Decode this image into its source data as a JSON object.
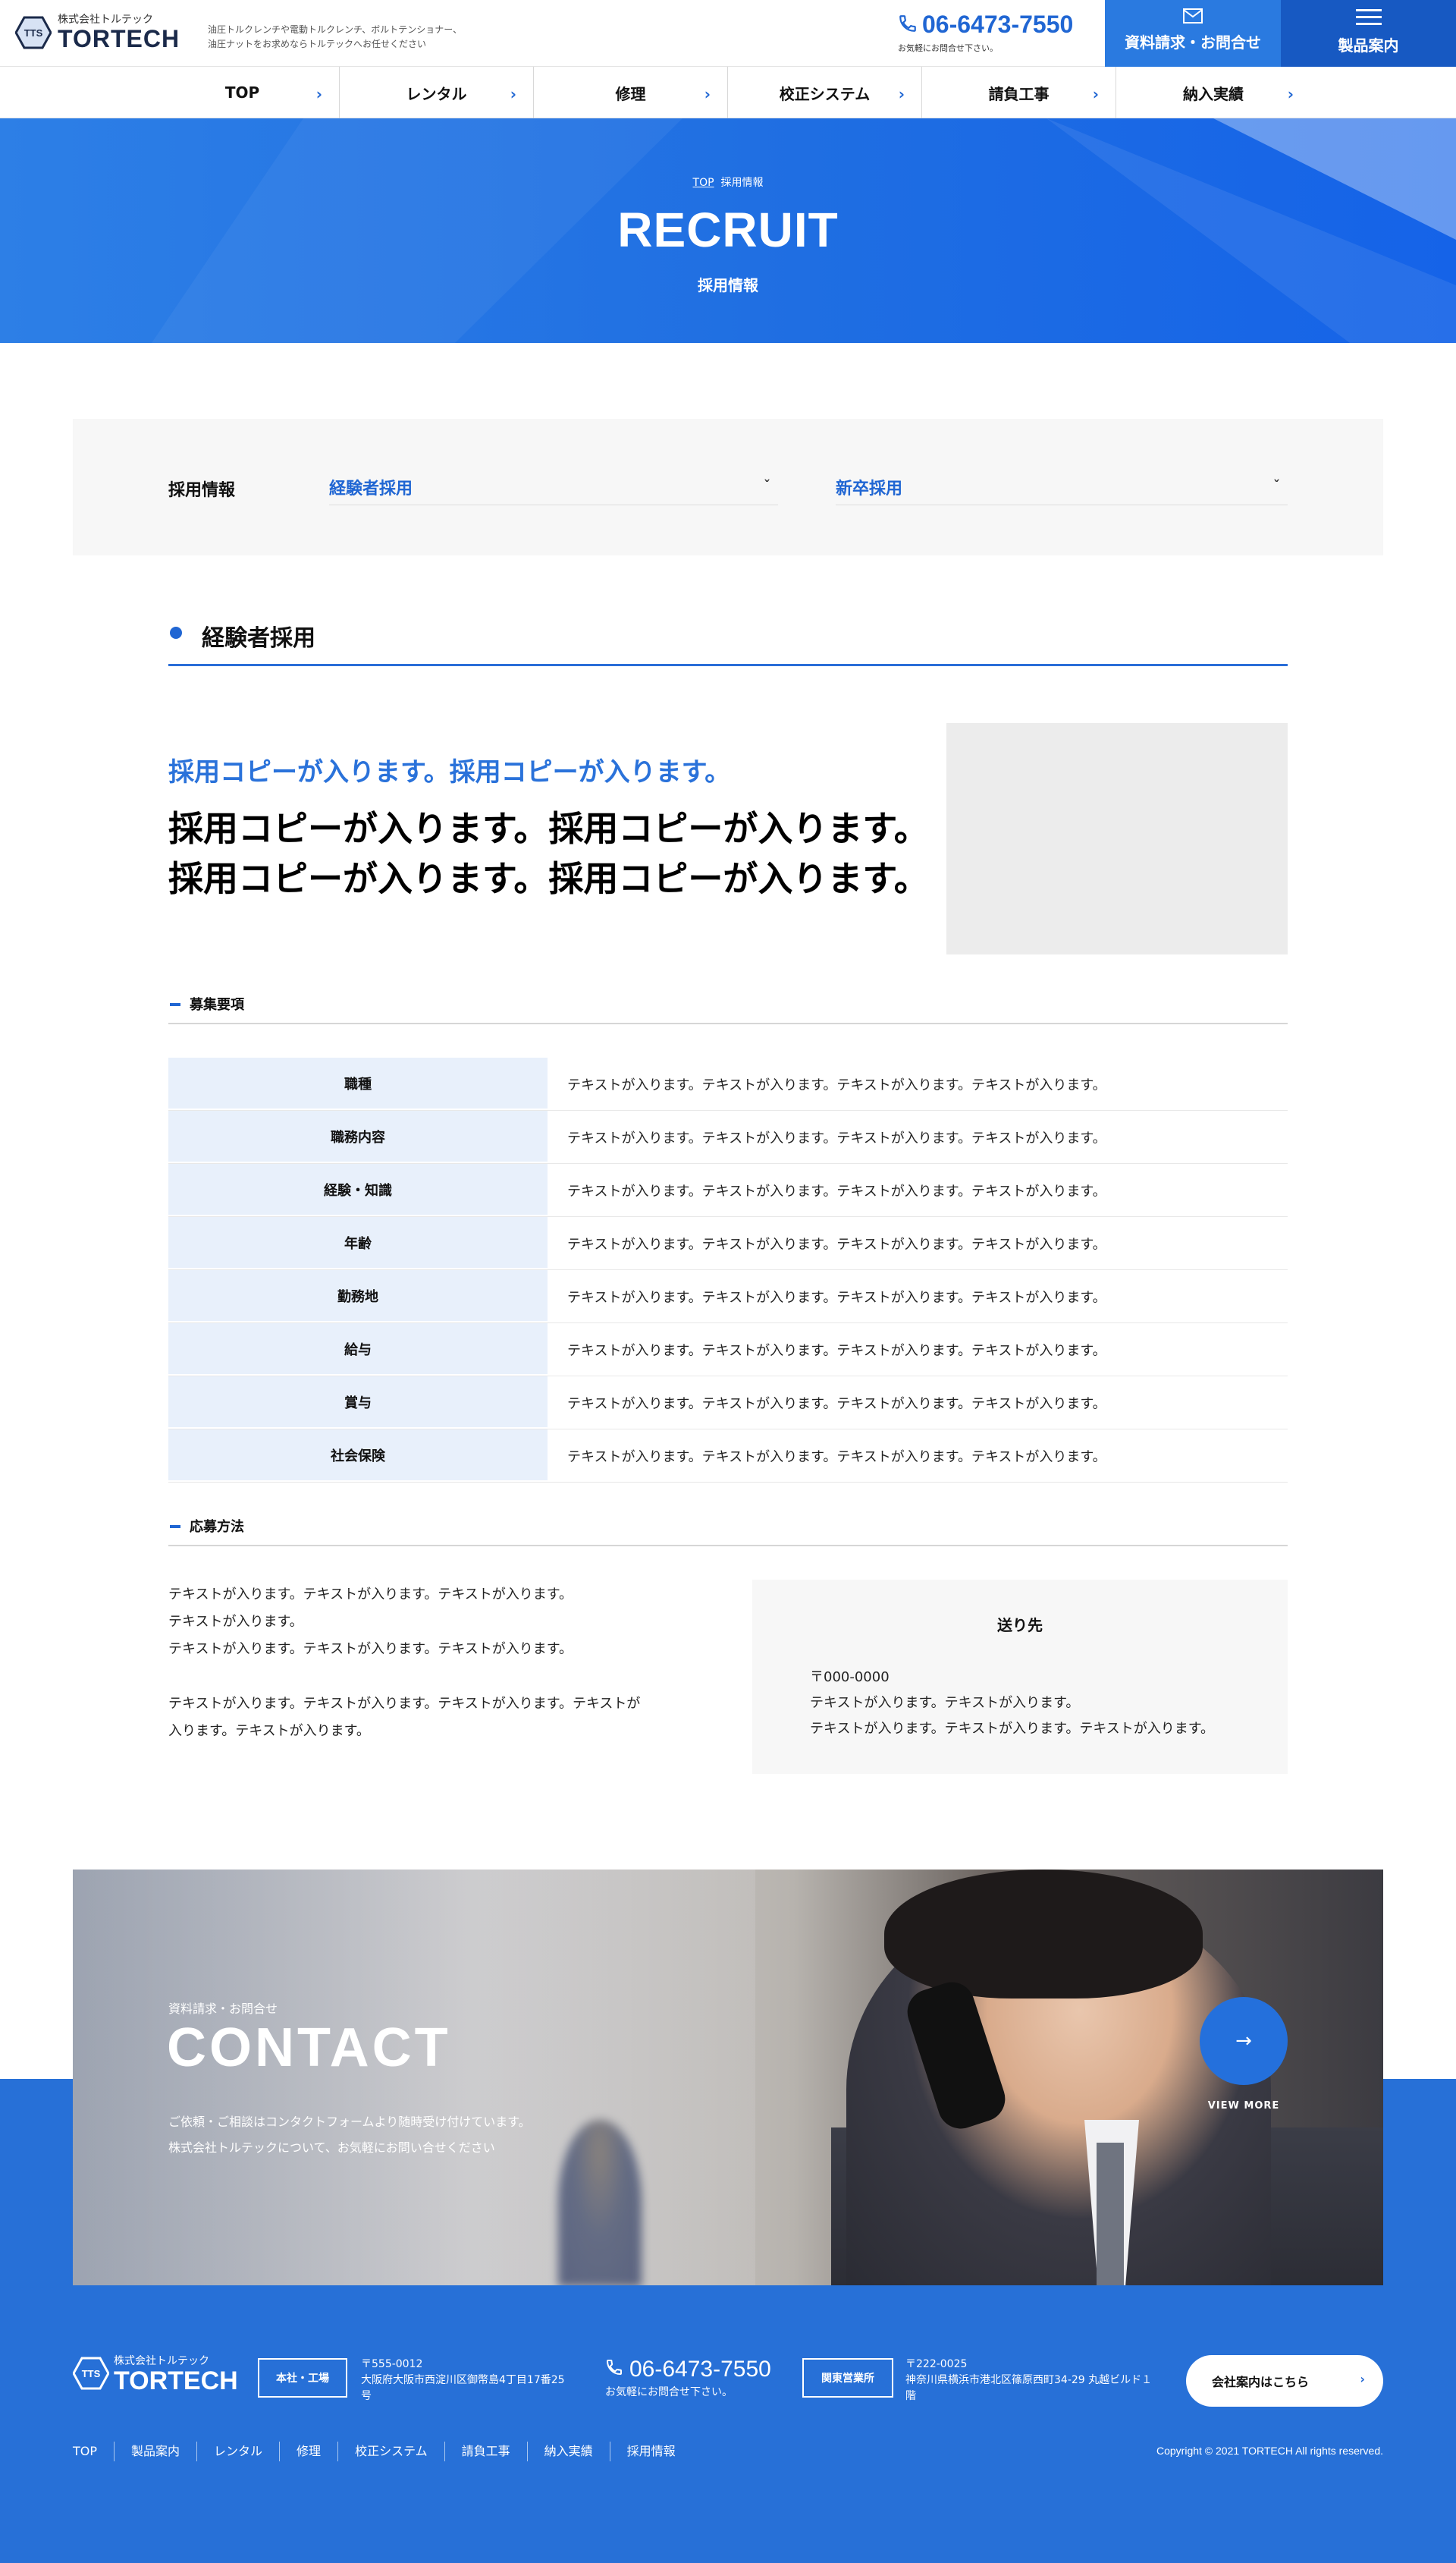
{
  "header": {
    "company_small": "株式会社トルテック",
    "brand": "TORTECH",
    "logo_mark": "TTS",
    "tagline_1": "油圧トルクレンチや電動トルクレンチ、ボルトテンショナー、",
    "tagline_2": "油圧ナットをお求めならトルテックへお任せください",
    "phone": "06-6473-7550",
    "phone_note": "お気軽にお問合せ下さい。",
    "docs_button": "資料請求・お問合せ",
    "products_button": "製品案内"
  },
  "nav": [
    "TOP",
    "レンタル",
    "修理",
    "校正システム",
    "請負工事",
    "納入実績"
  ],
  "hero": {
    "crumb_top": "TOP",
    "crumb_current": "採用情報",
    "title": "RECRUIT",
    "subtitle": "採用情報"
  },
  "filter": {
    "label": "採用情報",
    "option_1": "経験者採用",
    "option_2": "新卒採用"
  },
  "section": {
    "title": "経験者採用",
    "copy_blue": "採用コピーが入ります。採用コピーが入ります。",
    "copy_big_1": "採用コピーが入ります。採用コピーが入ります。",
    "copy_big_2": "採用コピーが入ります。採用コピーが入ります。"
  },
  "requirements": {
    "heading": "募集要項",
    "rows": [
      {
        "k": "職種",
        "v": "テキストが入ります。テキストが入ります。テキストが入ります。テキストが入ります。"
      },
      {
        "k": "職務内容",
        "v": "テキストが入ります。テキストが入ります。テキストが入ります。テキストが入ります。"
      },
      {
        "k": "経験・知識",
        "v": "テキストが入ります。テキストが入ります。テキストが入ります。テキストが入ります。"
      },
      {
        "k": "年齢",
        "v": "テキストが入ります。テキストが入ります。テキストが入ります。テキストが入ります。"
      },
      {
        "k": "勤務地",
        "v": "テキストが入ります。テキストが入ります。テキストが入ります。テキストが入ります。"
      },
      {
        "k": "給与",
        "v": "テキストが入ります。テキストが入ります。テキストが入ります。テキストが入ります。"
      },
      {
        "k": "賞与",
        "v": "テキストが入ります。テキストが入ります。テキストが入ります。テキストが入ります。"
      },
      {
        "k": "社会保険",
        "v": "テキストが入ります。テキストが入ります。テキストが入ります。テキストが入ります。"
      }
    ]
  },
  "apply": {
    "heading": "応募方法",
    "p1_line1": "テキストが入ります。テキストが入ります。テキストが入ります。",
    "p1_line2": "テキストが入ります。",
    "p1_line3": "テキストが入ります。テキストが入ります。テキストが入ります。",
    "p2_line1": "テキストが入ります。テキストが入ります。テキストが入ります。テキストが",
    "p2_line2": "入ります。テキストが入ります。",
    "box_title": "送り先",
    "box_zip": "〒000-0000",
    "box_line1": "テキストが入ります。テキストが入ります。",
    "box_line2": "テキストが入ります。テキストが入ります。テキストが入ります。"
  },
  "contact": {
    "label": "資料請求・お問合せ",
    "title": "CONTACT",
    "desc_1": "ご依頼・ご相談はコンタクトフォームより随時受け付けています。",
    "desc_2": "株式会社トルテックについて、お気軽にお問い合せください",
    "more": "VIEW MORE"
  },
  "footer": {
    "company_small": "株式会社トルテック",
    "brand": "TORTECH",
    "office1_badge": "本社・工場",
    "office1_zip": "〒555-0012",
    "office1_addr_1": "大阪府大阪市西淀川区御幣島4丁目17番25",
    "office1_addr_2": "号",
    "phone": "06-6473-7550",
    "phone_note": "お気軽にお問合せ下さい。",
    "office2_badge": "関東営業所",
    "office2_zip": "〒222-0025",
    "office2_addr_1": "神奈川県横浜市港北区篠原西町34-29 丸越ビルド１",
    "office2_addr_2": "階",
    "company_button": "会社案内はこちら",
    "links": [
      "TOP",
      "製品案内",
      "レンタル",
      "修理",
      "校正システム",
      "請負工事",
      "納入実績",
      "採用情報"
    ],
    "copyright": "Copyright © 2021 TORTECH All rights reserved."
  },
  "colors": {
    "primary": "#2066d3",
    "hero": "#1f6ee2",
    "footer": "#2770d7",
    "table_key": "#e8f0fb"
  }
}
